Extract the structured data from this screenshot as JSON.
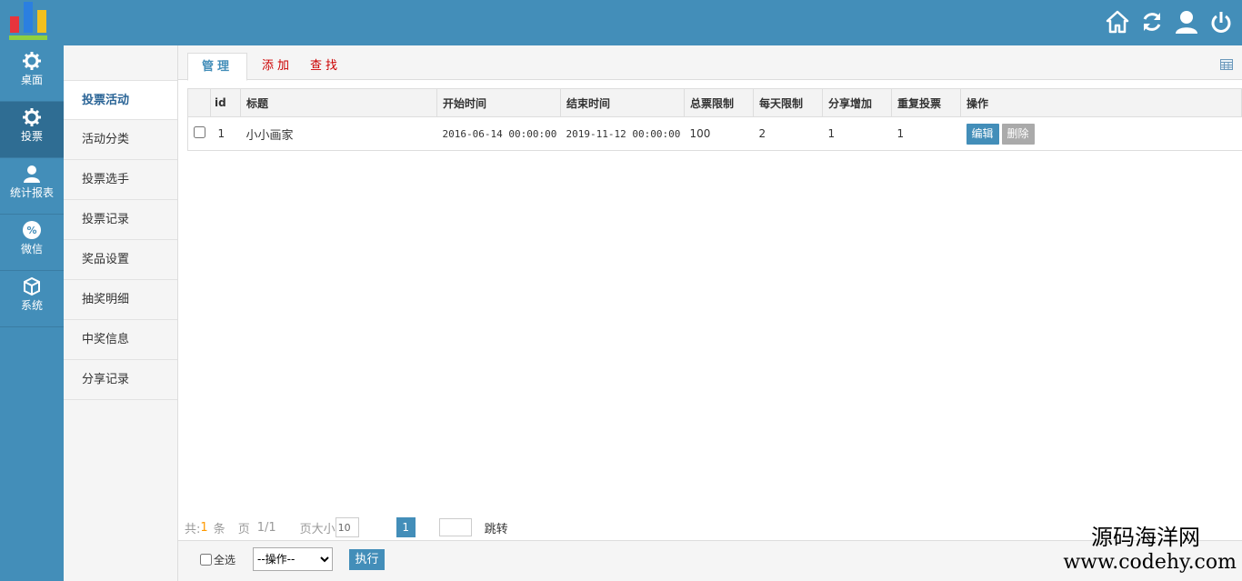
{
  "colors": {
    "primary": "#438eb9",
    "danger_tab": "#cc0000",
    "disabled": "#aaaaaa"
  },
  "topbar": {
    "icons": [
      "home-icon",
      "refresh-icon",
      "user-icon",
      "power-icon"
    ]
  },
  "sidebar": {
    "items": [
      {
        "label": "桌面",
        "icon": "gear-icon"
      },
      {
        "label": "投票",
        "icon": "gear-icon"
      },
      {
        "label": "统计报表",
        "icon": "user-icon"
      },
      {
        "label": "微信",
        "icon": "percent-icon"
      },
      {
        "label": "系统",
        "icon": "box-icon"
      }
    ]
  },
  "submenu": {
    "items": [
      "投票活动",
      "活动分类",
      "投票选手",
      "投票记录",
      "奖品设置",
      "抽奖明细",
      "中奖信息",
      "分享记录"
    ]
  },
  "tabs": [
    "管理",
    "添加",
    "查找"
  ],
  "table": {
    "headers": [
      "id",
      "标题",
      "开始时间",
      "结束时间",
      "总票限制",
      "每天限制",
      "分享增加",
      "重复投票",
      "操作"
    ],
    "rows": [
      {
        "id": "1",
        "title": "小小画家",
        "start": "2016-06-14 00:00:00",
        "end": "2019-11-12 00:00:00",
        "total_limit": "100",
        "daily_limit": "2",
        "share_add": "1",
        "repeat_vote": "1"
      }
    ],
    "edit_label": "编辑",
    "delete_label": "删除"
  },
  "pager": {
    "total_prefix": "共:",
    "total": "1",
    "total_suffix": "条",
    "page_label": "页",
    "page_info": "1/1",
    "size_label": "页大小",
    "size_value": "10",
    "current_page": "1",
    "jump_label": "跳转"
  },
  "bottom": {
    "select_all": "全选",
    "action_option": "--操作--",
    "execute": "执行"
  },
  "watermark": {
    "line1": "源码海洋网",
    "line2": "www.codehy.com"
  }
}
